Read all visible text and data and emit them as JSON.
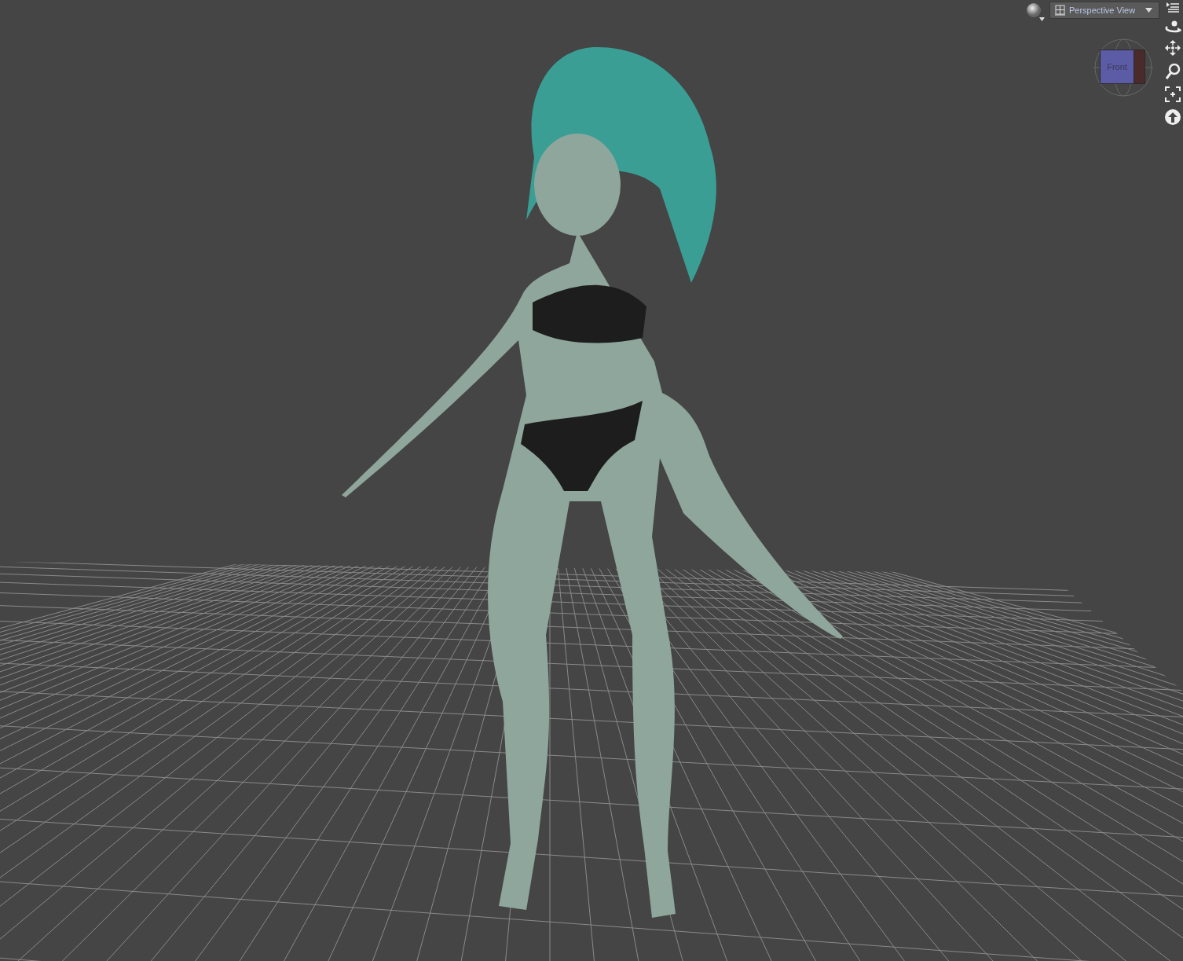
{
  "viewport": {
    "view_menu": {
      "label": "Perspective View"
    },
    "view_cube": {
      "face_label": "Front"
    }
  }
}
